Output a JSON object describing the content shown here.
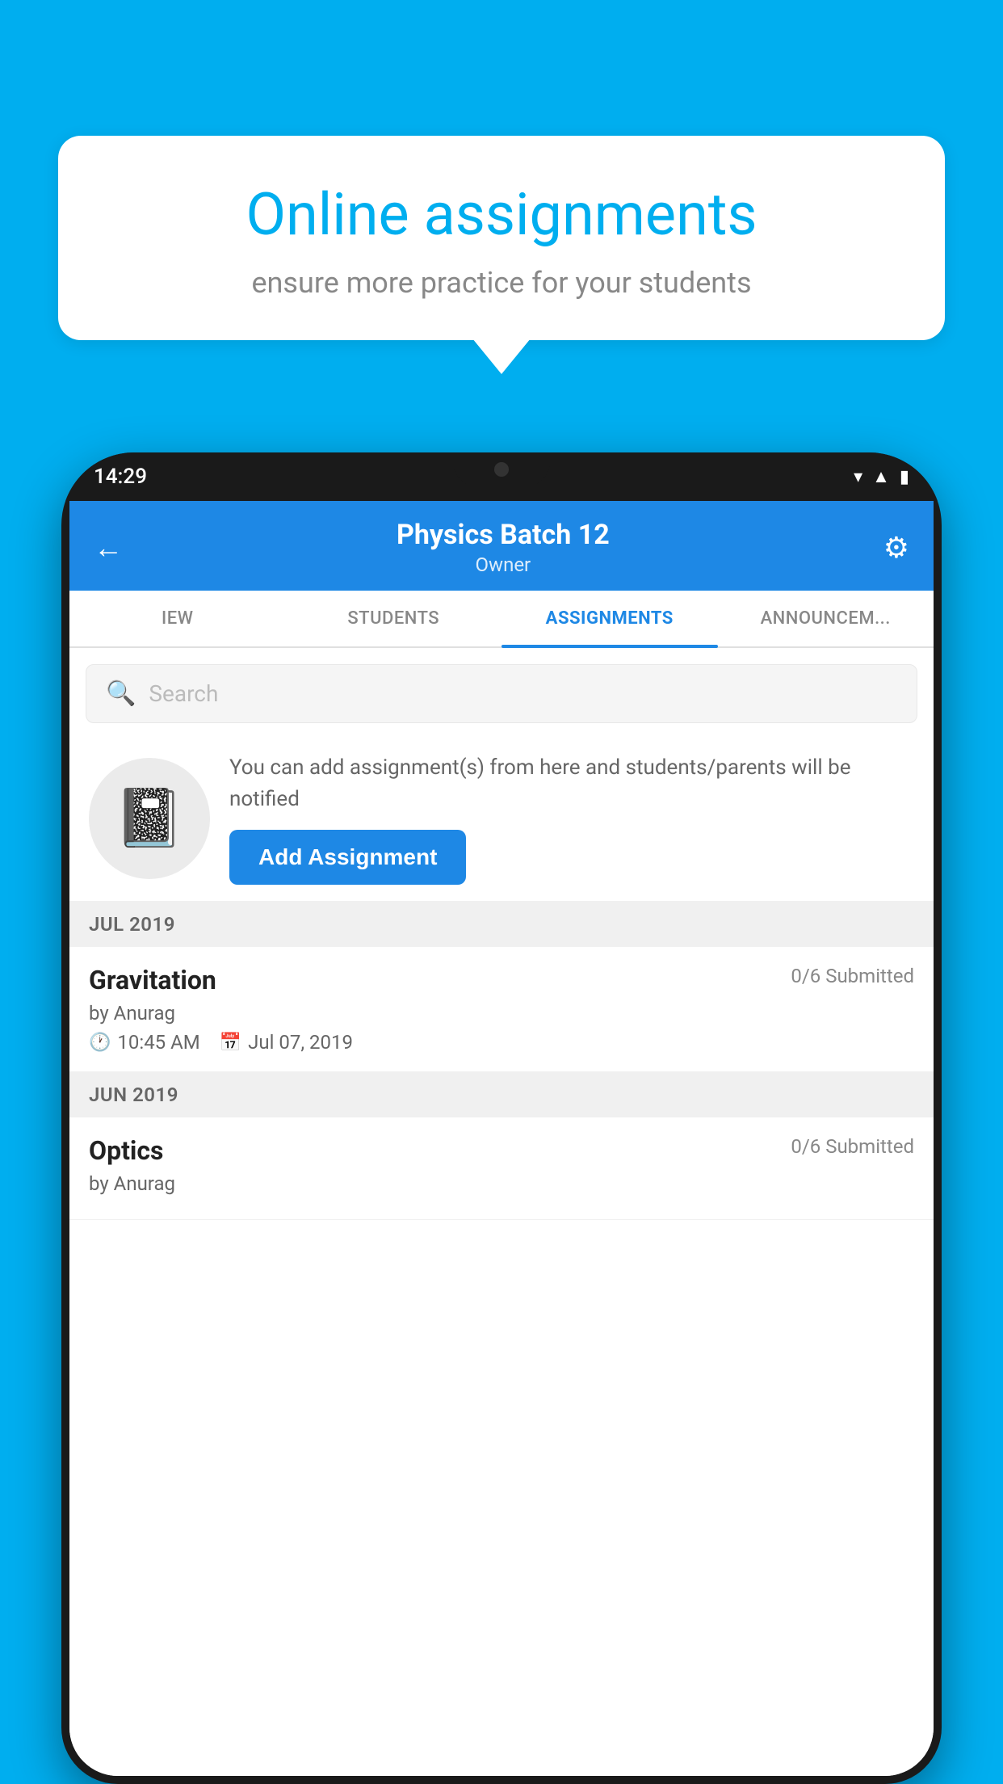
{
  "background": {
    "color": "#00AEEF"
  },
  "speech_bubble": {
    "title": "Online assignments",
    "subtitle": "ensure more practice for your students"
  },
  "phone": {
    "status_bar": {
      "time": "14:29",
      "icons": [
        "wifi",
        "signal",
        "battery"
      ]
    },
    "header": {
      "title": "Physics Batch 12",
      "subtitle": "Owner",
      "back_label": "←",
      "gear_label": "⚙"
    },
    "tabs": [
      {
        "label": "IEW",
        "active": false
      },
      {
        "label": "STUDENTS",
        "active": false
      },
      {
        "label": "ASSIGNMENTS",
        "active": true
      },
      {
        "label": "ANNOUNCEM...",
        "active": false
      }
    ],
    "search": {
      "placeholder": "Search"
    },
    "promo": {
      "description": "You can add assignment(s) from here and students/parents will be notified",
      "button_label": "Add Assignment"
    },
    "sections": [
      {
        "label": "JUL 2019",
        "assignments": [
          {
            "name": "Gravitation",
            "submitted": "0/6 Submitted",
            "by": "by Anurag",
            "time": "10:45 AM",
            "date": "Jul 07, 2019"
          }
        ]
      },
      {
        "label": "JUN 2019",
        "assignments": [
          {
            "name": "Optics",
            "submitted": "0/6 Submitted",
            "by": "by Anurag",
            "time": "",
            "date": ""
          }
        ]
      }
    ]
  }
}
